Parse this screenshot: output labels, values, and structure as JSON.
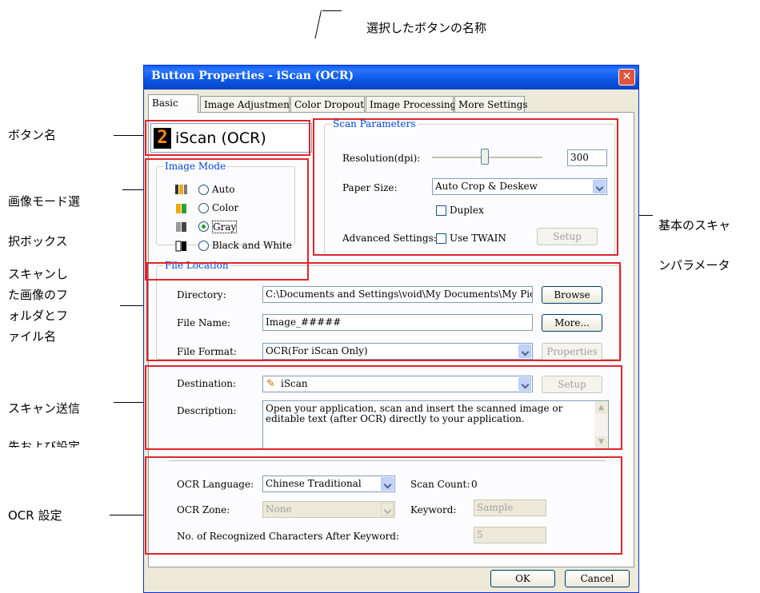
{
  "annotations": {
    "top": "選択したボタンの名称",
    "button_name": "ボタン名",
    "image_mode_1": "画像モード選",
    "image_mode_2": "択ボックス",
    "folder_1": "スキャンし",
    "folder_2": "た画像のフ",
    "folder_3": "ォルダとフ",
    "folder_4": "ァイル名",
    "basic_1": "基本のスキャ",
    "basic_2": "ンパラメータ",
    "destination_1": "スキャン送信",
    "destination_2": "先および設定",
    "ocr": "OCR 設定"
  },
  "dialog": {
    "title": "Button Properties - iScan (OCR)",
    "close": "✕",
    "tabs": [
      "Basic",
      "Image Adjustment",
      "Color Dropout",
      "Image Processing",
      "More Settings"
    ],
    "button_number": "2",
    "button_name": "iScan (OCR)",
    "image_mode": {
      "legend": "Image Mode",
      "options": [
        "Auto",
        "Color",
        "Gray",
        "Black and White"
      ],
      "selected": "Gray"
    },
    "scan_parameters": {
      "legend": "Scan Parameters",
      "resolution_label": "Resolution(dpi):",
      "resolution_value": "300",
      "resolution_slider_fraction": 0.5,
      "paper_size_label": "Paper Size:",
      "paper_size_value": "Auto Crop & Deskew",
      "duplex_label": "Duplex",
      "advanced_label": "Advanced Settings:",
      "use_twain_label": "Use TWAIN",
      "setup_button": "Setup"
    },
    "file_location": {
      "legend": "File Location",
      "directory_label": "Directory:",
      "directory_value": "C:\\Documents and Settings\\void\\My Documents\\My Pictures",
      "browse_button": "Browse",
      "file_name_label": "File Name:",
      "file_name_value": "Image_#####",
      "more_button": "More...",
      "file_format_label": "File Format:",
      "file_format_value": "OCR(For iScan Only)",
      "properties_button": "Properties"
    },
    "destination": {
      "label": "Destination:",
      "value": "iScan",
      "setup_button": "Setup",
      "description_label": "Description:",
      "description_value": "Open your application, scan and insert the scanned image or editable text (after OCR) directly to your application."
    },
    "ocr": {
      "language_label": "OCR Language:",
      "language_value": "Chinese Traditional",
      "scan_count_label": "Scan Count:",
      "scan_count_value": "0",
      "zone_label": "OCR Zone:",
      "zone_value": "None",
      "keyword_label": "Keyword:",
      "keyword_value": "Sample",
      "recognized_label": "No. of Recognized Characters After Keyword:",
      "recognized_value": "5"
    },
    "ok_button": "OK",
    "cancel_button": "Cancel"
  },
  "colors": {
    "highlight": "#e0252d",
    "titlebar": "#0a5ffd",
    "dialog_bg": "#ece9d8"
  }
}
